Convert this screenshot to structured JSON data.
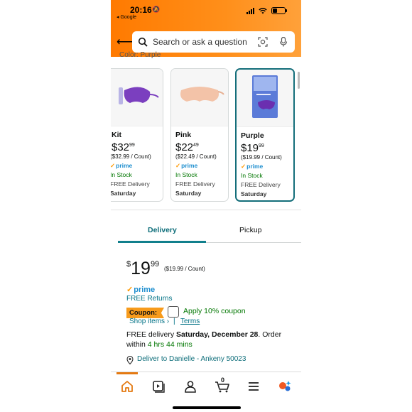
{
  "status_bar": {
    "time": "20:16",
    "back_app": "◂ Google"
  },
  "search": {
    "placeholder": "Search or ask a question"
  },
  "color_label": "Color: Purple",
  "variants": [
    {
      "name": "Kit",
      "price_whole": "32",
      "price_frac": "99",
      "unit_price": "($32.99 / Count)",
      "prime": "prime",
      "stock": "In Stock",
      "delivery": "FREE Delivery",
      "day": "Saturday"
    },
    {
      "name": "Pink",
      "price_whole": "22",
      "price_frac": "49",
      "unit_price": "($22.49 / Count)",
      "prime": "prime",
      "stock": "In Stock",
      "delivery": "FREE Delivery",
      "day": "Saturday"
    },
    {
      "name": "Purple",
      "price_whole": "19",
      "price_frac": "99",
      "unit_price": "($19.99 / Count)",
      "prime": "prime",
      "stock": "In Stock",
      "delivery": "FREE Delivery",
      "day": "Saturday"
    }
  ],
  "tabs": {
    "delivery": "Delivery",
    "pickup": "Pickup"
  },
  "buybox": {
    "currency": "$",
    "price_whole": "19",
    "price_frac": "99",
    "unit_price": "($19.99 / Count)",
    "prime": "prime",
    "returns": "FREE Returns",
    "coupon_badge": "Coupon:",
    "coupon_text": "Apply 10% coupon",
    "shop_items": "Shop items ›",
    "separator": "|",
    "terms": "Terms",
    "free_delivery_prefix": "FREE delivery ",
    "delivery_date": "Saturday, December 28",
    "order_within_prefix": ". Order within ",
    "order_within_time": "4 hrs 44 mins",
    "deliver_to": "Deliver to Danielle - Ankeny 50023"
  },
  "cart": {
    "count": "0"
  },
  "colors": {
    "accent": "#ff7a00",
    "teal": "#146e7a",
    "prime_blue": "#1f8fcf",
    "green": "#007600"
  }
}
